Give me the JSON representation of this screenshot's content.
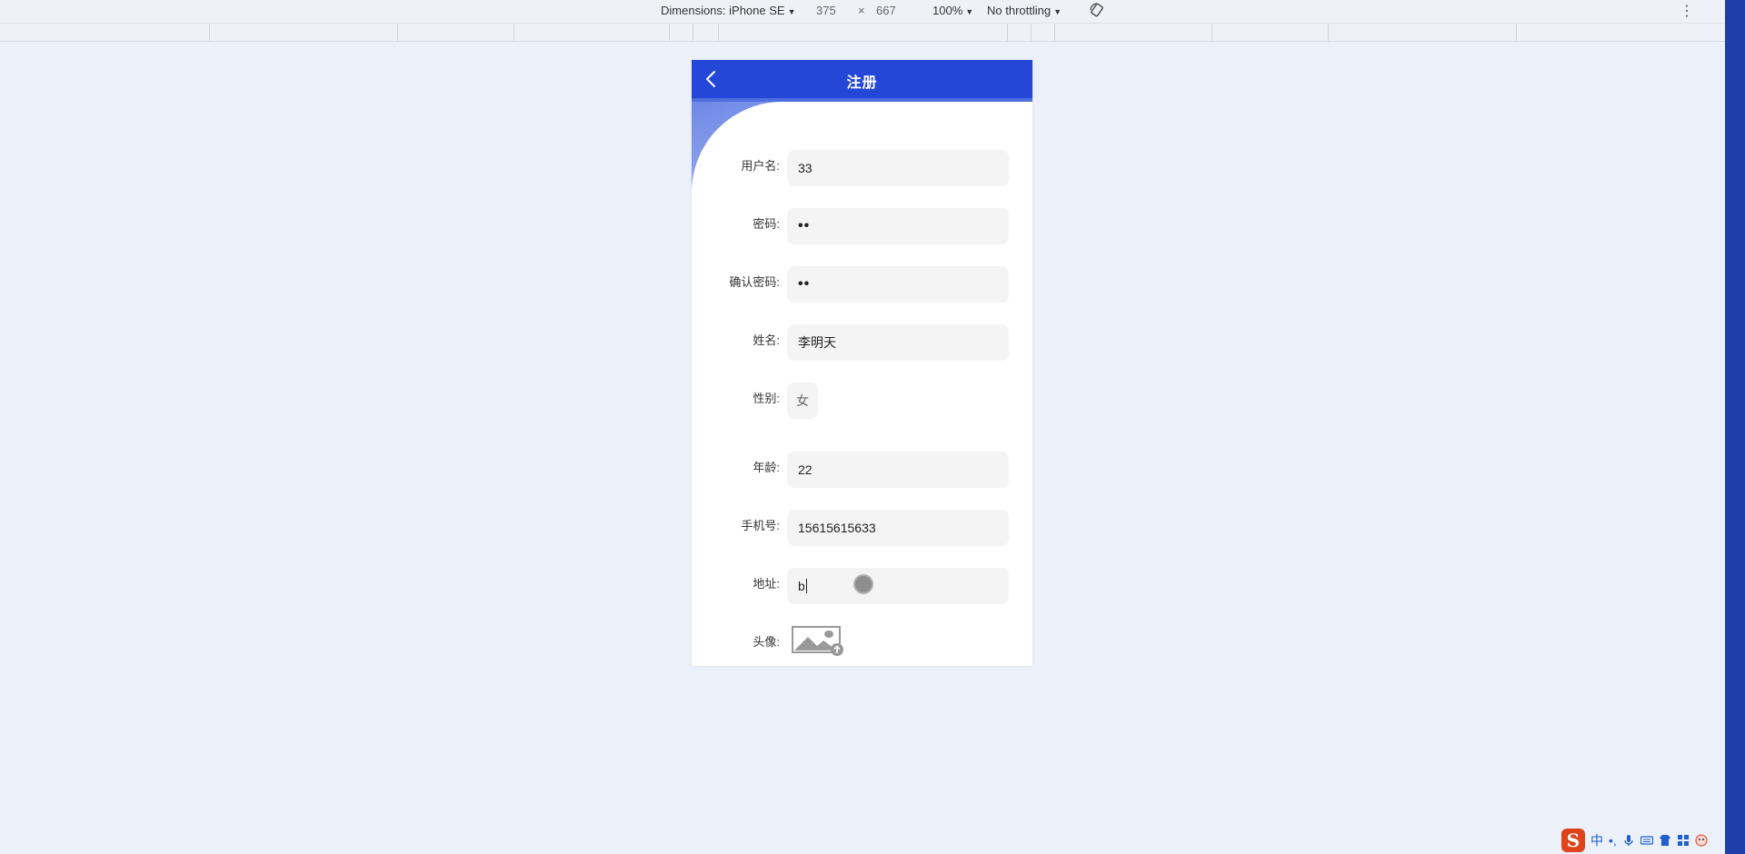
{
  "devtools": {
    "dimensions_label": "Dimensions: iPhone SE",
    "width": "375",
    "times": "×",
    "height": "667",
    "zoom": "100%",
    "throttling": "No throttling",
    "more": "⋮"
  },
  "page": {
    "title": "注册",
    "accent_color": "#2547d8"
  },
  "form": {
    "username": {
      "label": "用户名:",
      "value": "33"
    },
    "password": {
      "label": "密码:",
      "value": "••"
    },
    "confirm_password": {
      "label": "确认密码:",
      "value": "••"
    },
    "name": {
      "label": "姓名:",
      "value": "李明天"
    },
    "gender": {
      "label": "性别:",
      "value": "女"
    },
    "age": {
      "label": "年龄:",
      "value": "22"
    },
    "phone": {
      "label": "手机号:",
      "value": "15615615633"
    },
    "address": {
      "label": "地址:",
      "value": "b"
    },
    "avatar": {
      "label": "头像:",
      "icon": "image-upload-icon"
    }
  },
  "taskbar": {
    "ime_logo": "S",
    "ime_lang": "中",
    "ime_punct": "•,"
  }
}
